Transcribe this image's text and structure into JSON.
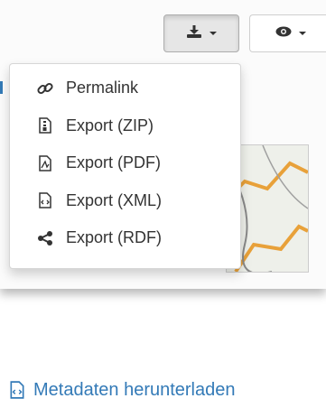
{
  "toolbar": {
    "download_icon": "download-icon",
    "view_icon": "eye-icon",
    "caret_icon": "caret-down-icon"
  },
  "dropdown": {
    "items": [
      {
        "label": "Permalink",
        "icon": "link-icon"
      },
      {
        "label": "Export (ZIP)",
        "icon": "file-zip-icon"
      },
      {
        "label": "Export (PDF)",
        "icon": "file-pdf-icon"
      },
      {
        "label": "Export (XML)",
        "icon": "file-xml-icon"
      },
      {
        "label": "Export (RDF)",
        "icon": "share-icon"
      }
    ]
  },
  "metadata_link": {
    "label": "Metadaten herunterladen",
    "icon": "file-xml-icon"
  },
  "colors": {
    "link": "#337ab7",
    "text": "#333333",
    "map_route": "#e8a13a"
  }
}
